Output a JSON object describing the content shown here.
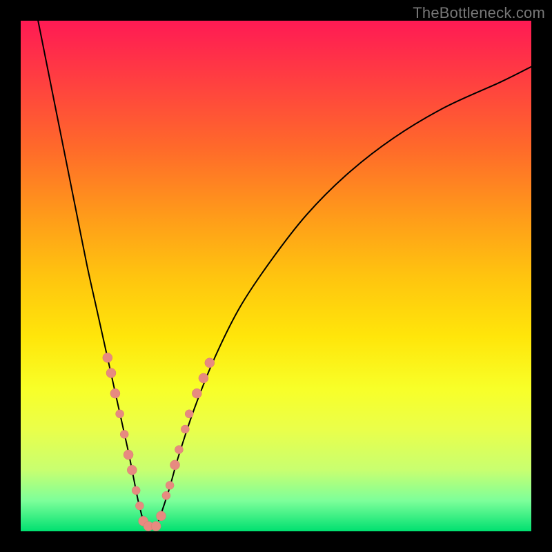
{
  "watermark": "TheBottleneck.com",
  "colors": {
    "frame": "#000000",
    "gradient_top": "#ff1a54",
    "gradient_bottom": "#00e070",
    "curve": "#000000",
    "marker_fill": "#e78a80",
    "marker_stroke": "#d87a70"
  },
  "chart_data": {
    "type": "line",
    "title": "",
    "xlabel": "",
    "ylabel": "",
    "xlim": [
      0,
      100
    ],
    "ylim": [
      0,
      100
    ],
    "series": [
      {
        "name": "left-branch",
        "x": [
          3,
          5,
          7,
          9,
          11,
          13,
          15,
          17,
          19,
          21,
          22,
          23,
          24
        ],
        "y": [
          102,
          92,
          82,
          72,
          62,
          52,
          43,
          34,
          25,
          16,
          11,
          6,
          2
        ]
      },
      {
        "name": "right-branch",
        "x": [
          27,
          29,
          31,
          34,
          38,
          43,
          49,
          56,
          64,
          73,
          83,
          94,
          100
        ],
        "y": [
          2,
          8,
          15,
          24,
          34,
          44,
          53,
          62,
          70,
          77,
          83,
          88,
          91
        ]
      }
    ],
    "markers": [
      {
        "branch": "left",
        "x": 17.0,
        "y": 34,
        "r": 7
      },
      {
        "branch": "left",
        "x": 17.7,
        "y": 31,
        "r": 7
      },
      {
        "branch": "left",
        "x": 18.5,
        "y": 27,
        "r": 7
      },
      {
        "branch": "left",
        "x": 19.4,
        "y": 23,
        "r": 6
      },
      {
        "branch": "left",
        "x": 20.3,
        "y": 19,
        "r": 6
      },
      {
        "branch": "left",
        "x": 21.1,
        "y": 15,
        "r": 7
      },
      {
        "branch": "left",
        "x": 21.8,
        "y": 12,
        "r": 7
      },
      {
        "branch": "left",
        "x": 22.6,
        "y": 8,
        "r": 6
      },
      {
        "branch": "left",
        "x": 23.3,
        "y": 5,
        "r": 6
      },
      {
        "branch": "left",
        "x": 24.0,
        "y": 2,
        "r": 7
      },
      {
        "branch": "left",
        "x": 25.0,
        "y": 1,
        "r": 7
      },
      {
        "branch": "right",
        "x": 26.5,
        "y": 1,
        "r": 7
      },
      {
        "branch": "right",
        "x": 27.5,
        "y": 3,
        "r": 7
      },
      {
        "branch": "right",
        "x": 28.5,
        "y": 7,
        "r": 6
      },
      {
        "branch": "right",
        "x": 29.2,
        "y": 9,
        "r": 6
      },
      {
        "branch": "right",
        "x": 30.2,
        "y": 13,
        "r": 7
      },
      {
        "branch": "right",
        "x": 31.0,
        "y": 16,
        "r": 6
      },
      {
        "branch": "right",
        "x": 32.2,
        "y": 20,
        "r": 6
      },
      {
        "branch": "right",
        "x": 33.0,
        "y": 23,
        "r": 6
      },
      {
        "branch": "right",
        "x": 34.5,
        "y": 27,
        "r": 7
      },
      {
        "branch": "right",
        "x": 35.8,
        "y": 30,
        "r": 7
      },
      {
        "branch": "right",
        "x": 37.0,
        "y": 33,
        "r": 7
      }
    ]
  }
}
